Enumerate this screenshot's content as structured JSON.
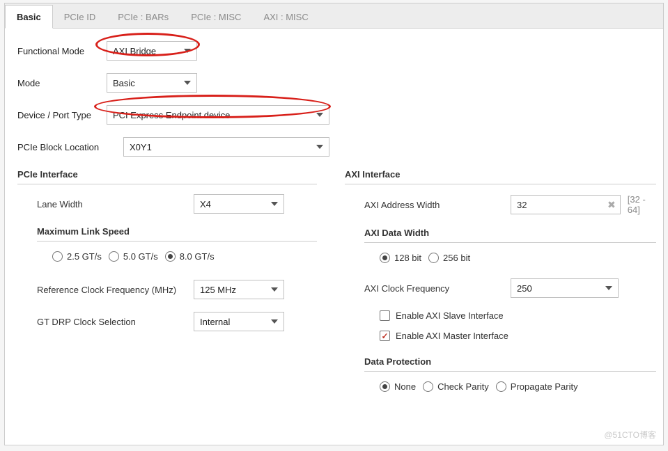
{
  "tabs": {
    "basic": "Basic",
    "pcieid": "PCIe ID",
    "bars": "PCIe : BARs",
    "misc": "PCIe : MISC",
    "aximisc": "AXI : MISC"
  },
  "top": {
    "functional_mode_label": "Functional Mode",
    "functional_mode_value": "AXI Bridge",
    "mode_label": "Mode",
    "mode_value": "Basic",
    "device_port_label": "Device / Port Type",
    "device_port_value": "PCI Express Endpoint device",
    "block_loc_label": "PCIe Block Location",
    "block_loc_value": "X0Y1"
  },
  "pcie_if": {
    "title": "PCIe Interface",
    "lane_width_label": "Lane Width",
    "lane_width_value": "X4",
    "max_link_title": "Maximum Link Speed",
    "speed1": "2.5 GT/s",
    "speed2": "5.0 GT/s",
    "speed3": "8.0 GT/s",
    "refclk_label": "Reference Clock Frequency (MHz)",
    "refclk_value": "125 MHz",
    "gtdrp_label": "GT DRP Clock Selection",
    "gtdrp_value": "Internal"
  },
  "axi_if": {
    "title": "AXI Interface",
    "addr_width_label": "AXI Address Width",
    "addr_width_value": "32",
    "addr_width_range": "[32 - 64]",
    "data_width_title": "AXI Data Width",
    "dw1": "128 bit",
    "dw2": "256 bit",
    "clk_freq_label": "AXI Clock Frequency",
    "clk_freq_value": "250",
    "enable_slave": "Enable AXI Slave Interface",
    "enable_master": "Enable AXI Master Interface",
    "data_prot_title": "Data Protection",
    "dp1": "None",
    "dp2": "Check Parity",
    "dp3": "Propagate Parity"
  },
  "watermark": "@51CTO博客"
}
